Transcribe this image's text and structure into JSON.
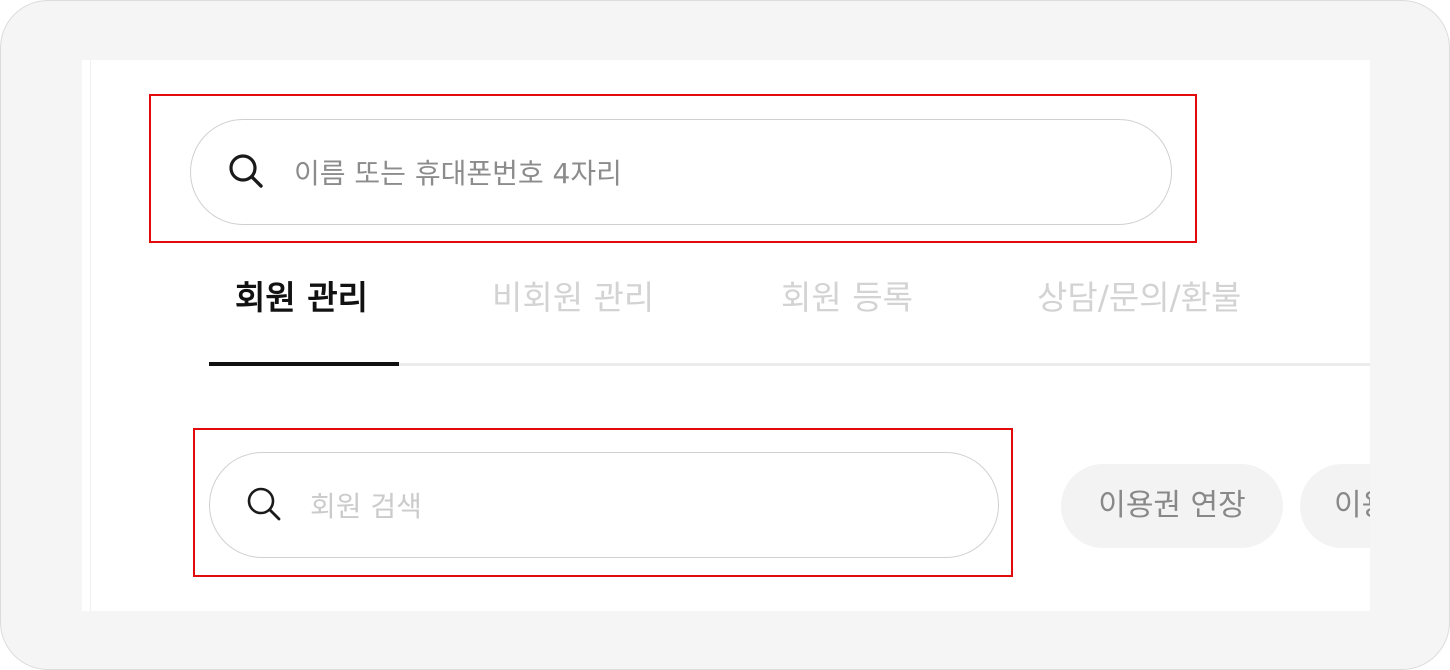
{
  "global_search": {
    "placeholder": "이름 또는 휴대폰번호 4자리",
    "icon": "search-icon"
  },
  "tabs": [
    {
      "label": "회원 관리",
      "active": true
    },
    {
      "label": "비회원 관리",
      "active": false
    },
    {
      "label": "회원 등록",
      "active": false
    },
    {
      "label": "상담/문의/환불",
      "active": false
    }
  ],
  "member_search": {
    "placeholder": "회원 검색",
    "icon": "search-icon"
  },
  "actions": [
    {
      "label": "이용권 연장"
    },
    {
      "label": "이용"
    }
  ],
  "colors": {
    "highlight": "#e10b0b",
    "active_tab": "#111111",
    "inactive_tab": "#d3d3d3",
    "chip_bg": "#f3f3f3",
    "chip_text": "#888888"
  }
}
